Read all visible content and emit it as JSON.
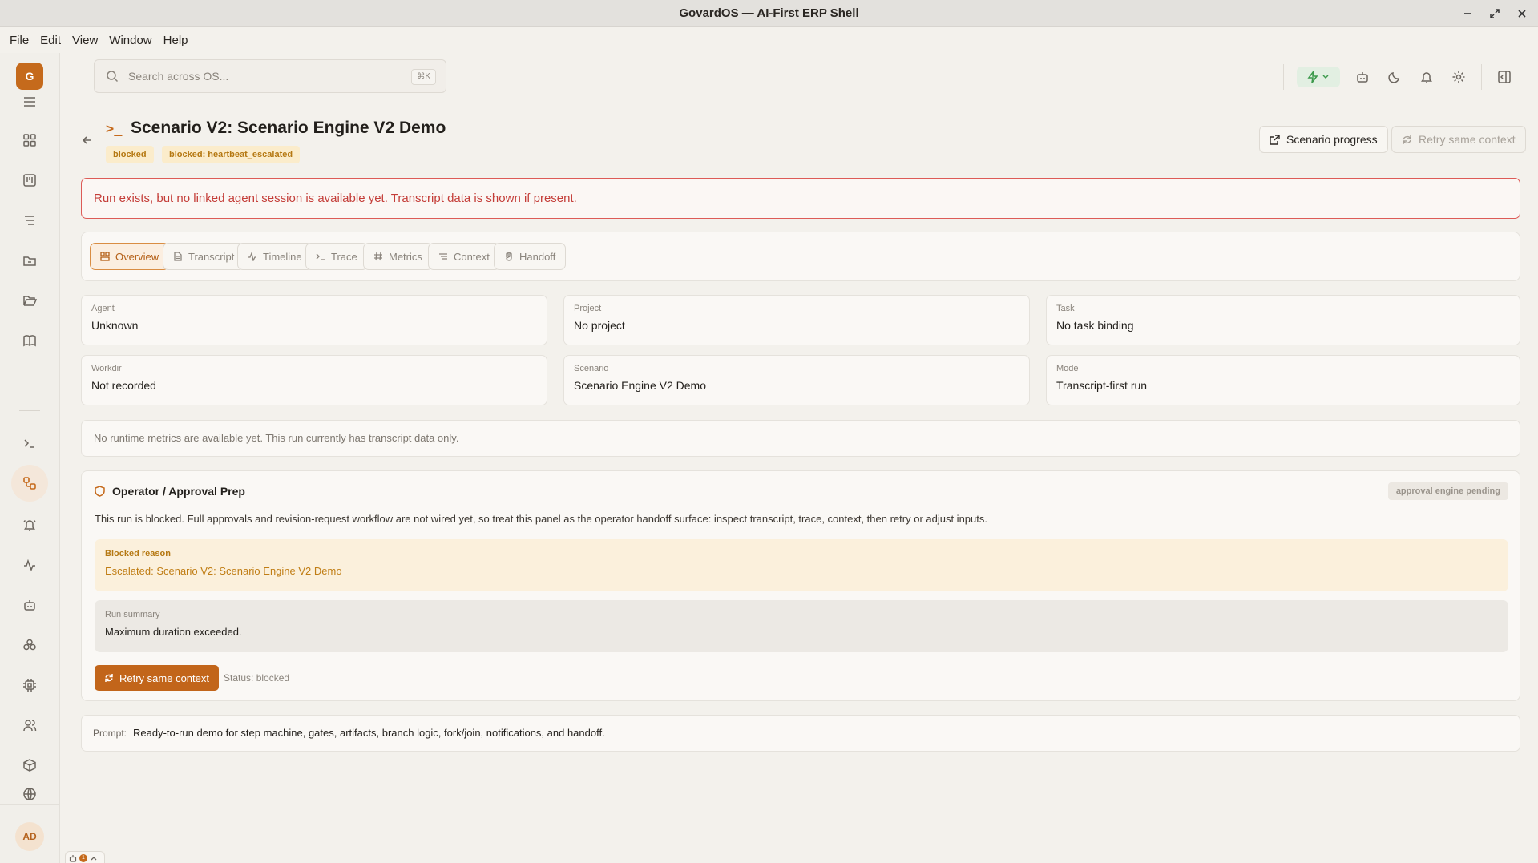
{
  "window": {
    "title": "GovardOS — AI-First ERP Shell"
  },
  "menu": [
    "File",
    "Edit",
    "View",
    "Window",
    "Help"
  ],
  "sidebar": {
    "avatar_letter": "G",
    "user_initials": "AD",
    "items": [
      {
        "icon": "menu-icon"
      },
      {
        "icon": "dashboard-grid-icon"
      },
      {
        "icon": "board-icon"
      },
      {
        "icon": "list-icon"
      },
      {
        "icon": "inbox-folder-icon"
      },
      {
        "icon": "folder-open-icon"
      },
      {
        "icon": "book-icon"
      },
      {
        "icon": "terminal-icon"
      },
      {
        "icon": "workflow-icon",
        "active": true
      },
      {
        "icon": "bell-ring-icon"
      },
      {
        "icon": "activity-icon"
      },
      {
        "icon": "bot-icon"
      },
      {
        "icon": "cluster-icon"
      },
      {
        "icon": "chip-icon"
      },
      {
        "icon": "users-icon"
      },
      {
        "icon": "package-icon"
      },
      {
        "icon": "globe-icon"
      }
    ]
  },
  "topbar": {
    "search_placeholder": "Search across OS...",
    "search_shortcut": "⌘K",
    "icons": [
      "bolt-icon",
      "bot-icon",
      "moon-icon",
      "bell-icon",
      "gear-icon",
      "panel-icon"
    ]
  },
  "header": {
    "title": "Scenario V2: Scenario Engine V2 Demo",
    "badges": [
      "blocked",
      "blocked: heartbeat_escalated"
    ],
    "progress_button": "Scenario progress",
    "retry_button": "Retry same context"
  },
  "alert": "Run exists, but no linked agent session is available yet. Transcript data is shown if present.",
  "tabs": [
    "Overview",
    "Transcript",
    "Timeline",
    "Trace",
    "Metrics",
    "Context",
    "Handoff"
  ],
  "fields": [
    {
      "label": "Agent",
      "value": "Unknown"
    },
    {
      "label": "Project",
      "value": "No project"
    },
    {
      "label": "Task",
      "value": "No task binding"
    },
    {
      "label": "Workdir",
      "value": "Not recorded"
    },
    {
      "label": "Scenario",
      "value": "Scenario Engine V2 Demo"
    },
    {
      "label": "Mode",
      "value": "Transcript-first run"
    }
  ],
  "metrics_note": "No runtime metrics are available yet. This run currently has transcript data only.",
  "operator": {
    "title": "Operator / Approval Prep",
    "pill": "approval engine pending",
    "description": "This run is blocked. Full approvals and revision-request workflow are not wired yet, so treat this panel as the operator handoff surface: inspect transcript, trace, context, then retry or adjust inputs.",
    "reason_label": "Blocked reason",
    "reason_value": "Escalated: Scenario V2: Scenario Engine V2 Demo",
    "summary_label": "Run summary",
    "summary_value": "Maximum duration exceeded.",
    "retry_button": "Retry same context",
    "status": "Status: blocked"
  },
  "prompt": {
    "label": "Prompt:",
    "value": "Ready-to-run demo for step machine, gates, artifacts, branch logic, fork/join, notifications, and handoff."
  },
  "footer_widget": {
    "count": "1"
  },
  "colors": {
    "accent": "#c56a1c",
    "danger": "#c43d38",
    "warning": "#b57812",
    "success": "#3d9a4c"
  }
}
